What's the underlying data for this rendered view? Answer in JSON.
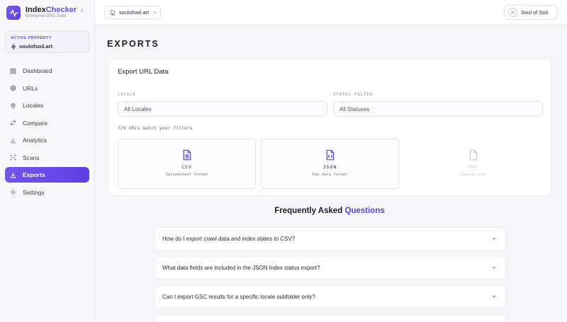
{
  "app": {
    "name_part1": "Index",
    "name_part2": "Checker",
    "subtitle": "Enterprise GSC Suite"
  },
  "sidebar": {
    "property_label": "ACTIVE PROPERTY",
    "property_value": "soulofsoil.art",
    "items": [
      {
        "label": "Dashboard",
        "icon": "dashboard-icon"
      },
      {
        "label": "URLs",
        "icon": "globe-icon"
      },
      {
        "label": "Locales",
        "icon": "map-pin-icon"
      },
      {
        "label": "Compare",
        "icon": "compare-icon"
      },
      {
        "label": "Analytics",
        "icon": "bar-chart-icon"
      },
      {
        "label": "Scans",
        "icon": "scan-icon"
      },
      {
        "label": "Exports",
        "icon": "download-icon",
        "active": true
      },
      {
        "label": "Settings",
        "icon": "gear-icon"
      }
    ]
  },
  "topbar": {
    "property": "soulofsoil.art",
    "account": "Soul of Soil"
  },
  "page": {
    "title": "EXPORTS"
  },
  "export_card": {
    "title": "Export URL Data",
    "locale_label": "LOCALE",
    "locale_value": "All Locales",
    "status_label": "STATUS FILTER",
    "status_value": "All Statuses",
    "match_text": "729 URLs match your filters",
    "options": [
      {
        "name": "CSV",
        "desc": "Spreadsheet format",
        "icon": "csv-file-icon"
      },
      {
        "name": "JSON",
        "desc": "Raw data format",
        "icon": "json-file-icon"
      },
      {
        "name": "PDF",
        "desc": "Coming soon",
        "icon": "pdf-file-icon",
        "disabled": true
      }
    ]
  },
  "faq": {
    "title_part1": "Frequently Asked",
    "title_part2": "Questions",
    "items": [
      "How do I export crawl data and index states to CSV?",
      "What data fields are included in the JSON index status export?",
      "Can I export GSC results for a specific locale subfolder only?"
    ]
  },
  "colors": {
    "accent": "#6a4ce8",
    "accent_dark": "#5d3fe3"
  }
}
